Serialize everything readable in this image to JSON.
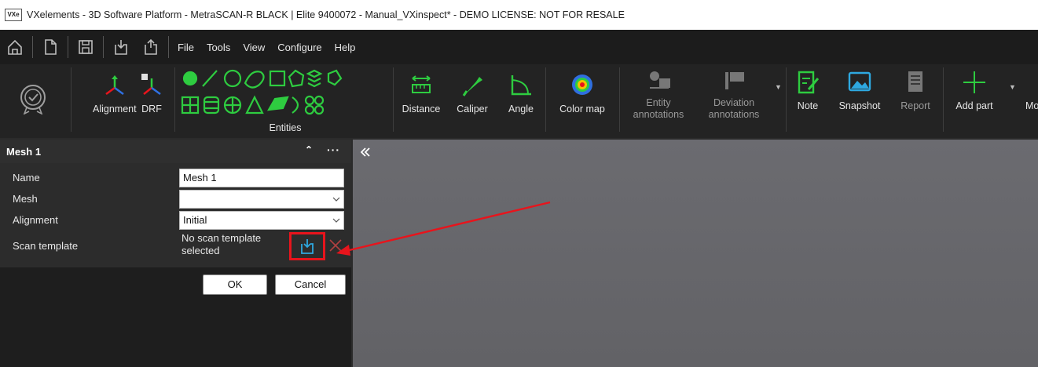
{
  "window": {
    "app_icon_text": "VXe",
    "title": "VXelements - 3D Software Platform - MetraSCAN-R BLACK | Elite 9400072 - Manual_VXinspect* - DEMO LICENSE: NOT FOR RESALE"
  },
  "menu": [
    "File",
    "Tools",
    "View",
    "Configure",
    "Help"
  ],
  "ribbon": {
    "alignment": "Alignment",
    "drf": "DRF",
    "entities": "Entities",
    "distance": "Distance",
    "caliper": "Caliper",
    "angle": "Angle",
    "color_map": "Color map",
    "entity_annotations": [
      "Entity",
      "annotations"
    ],
    "deviation_annotations": [
      "Deviation",
      "annotations"
    ],
    "note": "Note",
    "snapshot": "Snapshot",
    "report": "Report",
    "add_part": "Add part",
    "more_cut": "Mo"
  },
  "panel": {
    "title": "Mesh 1",
    "collapse_icon": "chevron-up-icon",
    "more_icon": "more-icon",
    "fields": {
      "name": {
        "label": "Name",
        "value": "Mesh 1"
      },
      "mesh": {
        "label": "Mesh",
        "value": ""
      },
      "alignment": {
        "label": "Alignment",
        "value": "Initial"
      },
      "scan_template": {
        "label": "Scan template",
        "value_line1": "No scan template",
        "value_line2": "selected"
      }
    },
    "ok": "OK",
    "cancel": "Cancel"
  },
  "viewport": {
    "collapse_icon": "double-chevron-left-icon"
  },
  "colors": {
    "accent_green": "#2ecc40",
    "annotation_red": "#e8141c",
    "icon_blue": "#2ea8e0"
  }
}
